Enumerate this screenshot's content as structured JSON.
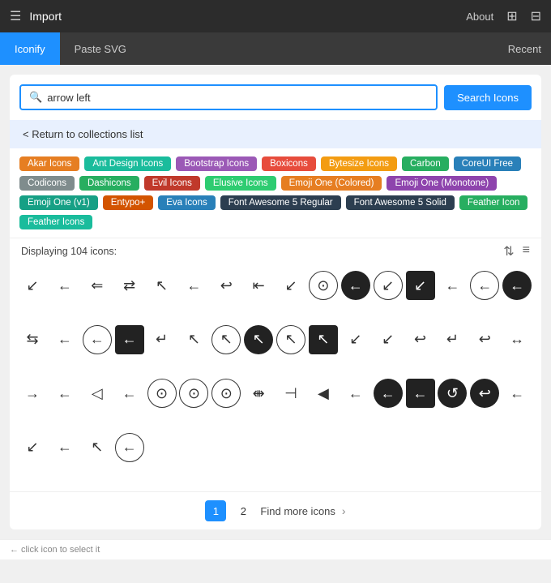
{
  "topbar": {
    "title": "Import",
    "about_label": "About"
  },
  "tabs": {
    "iconify_label": "Iconify",
    "paste_svg_label": "Paste SVG",
    "recent_label": "Recent"
  },
  "search": {
    "placeholder": "arrow left",
    "value": "arrow left",
    "button_label": "Search Icons"
  },
  "return": {
    "label": "< Return to collections list"
  },
  "tags": [
    {
      "label": "Akar Icons",
      "color": "#e67e22"
    },
    {
      "label": "Ant Design Icons",
      "color": "#1abc9c"
    },
    {
      "label": "Bootstrap Icons",
      "color": "#9b59b6"
    },
    {
      "label": "Boxicons",
      "color": "#e74c3c"
    },
    {
      "label": "Bytesize Icons",
      "color": "#f39c12"
    },
    {
      "label": "Carbon",
      "color": "#27ae60"
    },
    {
      "label": "CoreUI Free",
      "color": "#2980b9"
    },
    {
      "label": "Codicons",
      "color": "#7f8c8d"
    },
    {
      "label": "Dashicons",
      "color": "#27ae60"
    },
    {
      "label": "Evil Icons",
      "color": "#c0392b"
    },
    {
      "label": "Elusive Icons",
      "color": "#2ecc71"
    },
    {
      "label": "Emoji One (Colored)",
      "color": "#e67e22"
    },
    {
      "label": "Emoji One (Monotone)",
      "color": "#8e44ad"
    },
    {
      "label": "Emoji One (v1)",
      "color": "#16a085"
    },
    {
      "label": "Entypo+",
      "color": "#d35400"
    },
    {
      "label": "Eva Icons",
      "color": "#2980b9"
    },
    {
      "label": "Font Awesome 5 Regular",
      "color": "#2c3e50"
    },
    {
      "label": "Font Awesome 5 Solid",
      "color": "#2c3e50"
    },
    {
      "label": "Feather Icon",
      "color": "#27ae60"
    },
    {
      "label": "Feather Icons",
      "color": "#1abc9c"
    }
  ],
  "displaying": {
    "text": "Displaying 104 icons:"
  },
  "pagination": {
    "page1_label": "1",
    "page2_label": "2",
    "find_more_label": "Find more icons"
  },
  "bottom_hint": {
    "text": "← click icon to select it"
  }
}
